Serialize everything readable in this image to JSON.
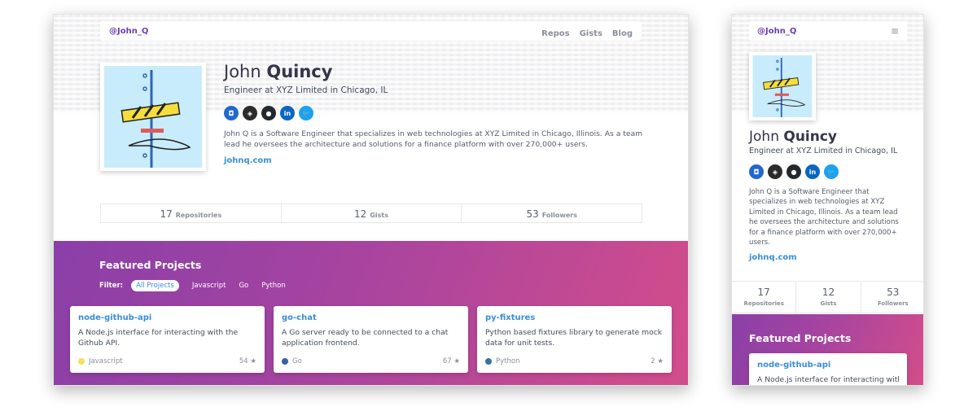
{
  "nav": {
    "handle": "@John_Q",
    "links": [
      "Repos",
      "Gists",
      "Blog"
    ]
  },
  "profile": {
    "first_name": "John ",
    "last_name": "Quincy",
    "title": "Engineer at XYZ Limited in Chicago, IL",
    "bio": "John Q is a Software Engineer that specializes in web technologies at XYZ Limited in Chicago, Illinois. As a team lead he oversees the architecture and solutions for a finance platform with over 270,000+ users.",
    "website": "johnq.com",
    "socials": [
      {
        "name": "bitbucket-icon",
        "glyph": "◘",
        "color": "#2167d1"
      },
      {
        "name": "codepen-icon",
        "glyph": "◈",
        "color": "#2b2b2b"
      },
      {
        "name": "github-icon",
        "glyph": "●",
        "color": "#24292e"
      },
      {
        "name": "linkedin-icon",
        "glyph": "in",
        "color": "#0a66c2"
      },
      {
        "name": "twitter-icon",
        "glyph": "🐦",
        "color": "#1da1f2"
      }
    ]
  },
  "stats": [
    {
      "value": "17",
      "label": "Repositories"
    },
    {
      "value": "12",
      "label": "Gists"
    },
    {
      "value": "53",
      "label": "Followers"
    }
  ],
  "featured": {
    "title": "Featured Projects",
    "filter_label": "Filter:",
    "filters": [
      "All Projects",
      "Javascript",
      "Go",
      "Python"
    ],
    "active_filter": "All Projects",
    "projects": [
      {
        "name": "node-github-api",
        "desc": "A Node.js interface for interacting with the Github API.",
        "lang": "Javascript",
        "lang_color": "#f1e05a",
        "stars": "54 ★"
      },
      {
        "name": "go-chat",
        "desc": "A Go server ready to be connected to a chat application frontend.",
        "lang": "Go",
        "lang_color": "#375eab",
        "stars": "67 ★"
      },
      {
        "name": "py-fixtures",
        "desc": "Python based fixtures library to generate mock data for unit tests.",
        "lang": "Python",
        "lang_color": "#3572a5",
        "stars": "2 ★"
      }
    ]
  },
  "mobile": {
    "menu_icon": "hamburger-menu-icon",
    "menu_glyph": "≡",
    "project_desc_visible": "A Node.js interface for interacting with"
  }
}
